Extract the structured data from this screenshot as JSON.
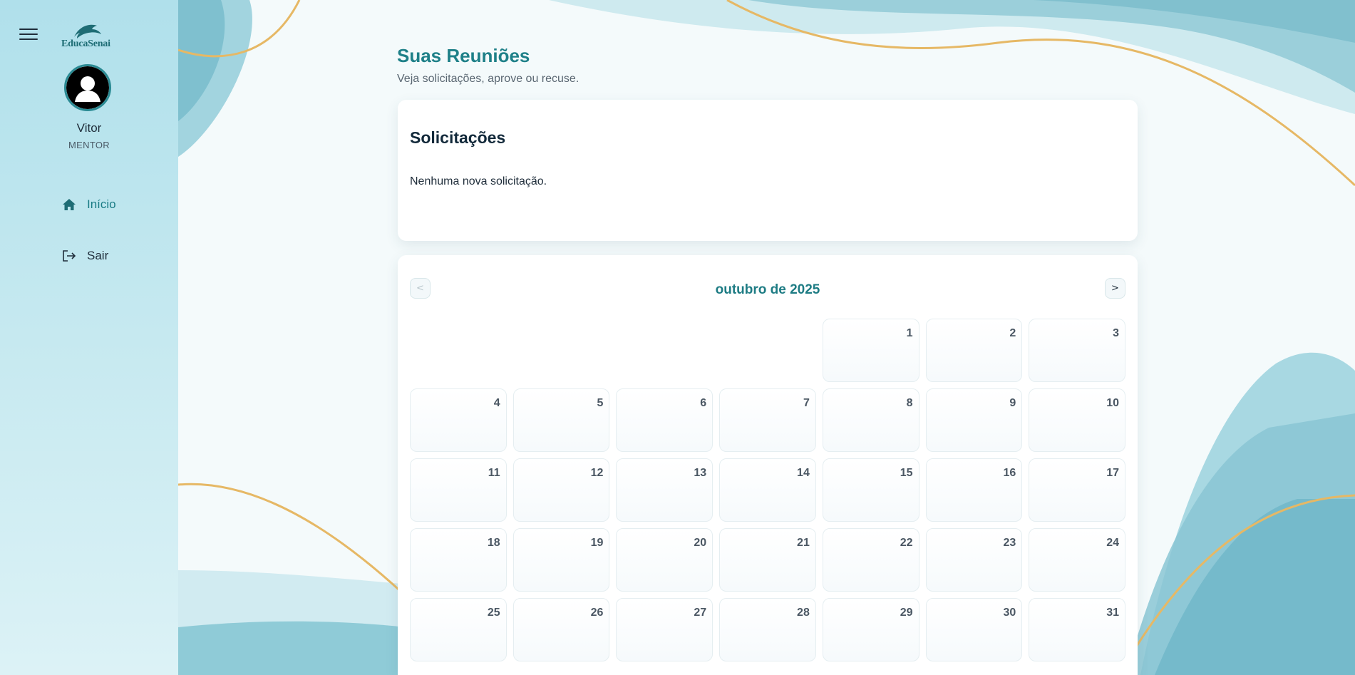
{
  "sidebar": {
    "logo_text": "EducaSenai",
    "user": {
      "name": "Vitor",
      "role": "MENTOR"
    },
    "nav": [
      {
        "label": "Início",
        "icon": "home-icon",
        "active": true
      },
      {
        "label": "Sair",
        "icon": "logout-icon",
        "active": false
      }
    ]
  },
  "main": {
    "title": "Suas Reuniões",
    "subtitle": "Veja solicitações, aprove ou recuse.",
    "requests": {
      "heading": "Solicitações",
      "empty_message": "Nenhuma nova solicitação."
    },
    "calendar": {
      "month_label": "outubro de 2025",
      "prev_label": "<",
      "next_label": ">",
      "leading_empty_days": 4,
      "days": [
        1,
        2,
        3,
        4,
        5,
        6,
        7,
        8,
        9,
        10,
        11,
        12,
        13,
        14,
        15,
        16,
        17,
        18,
        19,
        20,
        21,
        22,
        23,
        24,
        25,
        26,
        27,
        28,
        29,
        30,
        31
      ]
    }
  },
  "colors": {
    "accent": "#1e8088",
    "sidebar_bg": "#b0e0eb",
    "wave_teal": "#8cc9d6",
    "gold_line": "#e6b865"
  }
}
